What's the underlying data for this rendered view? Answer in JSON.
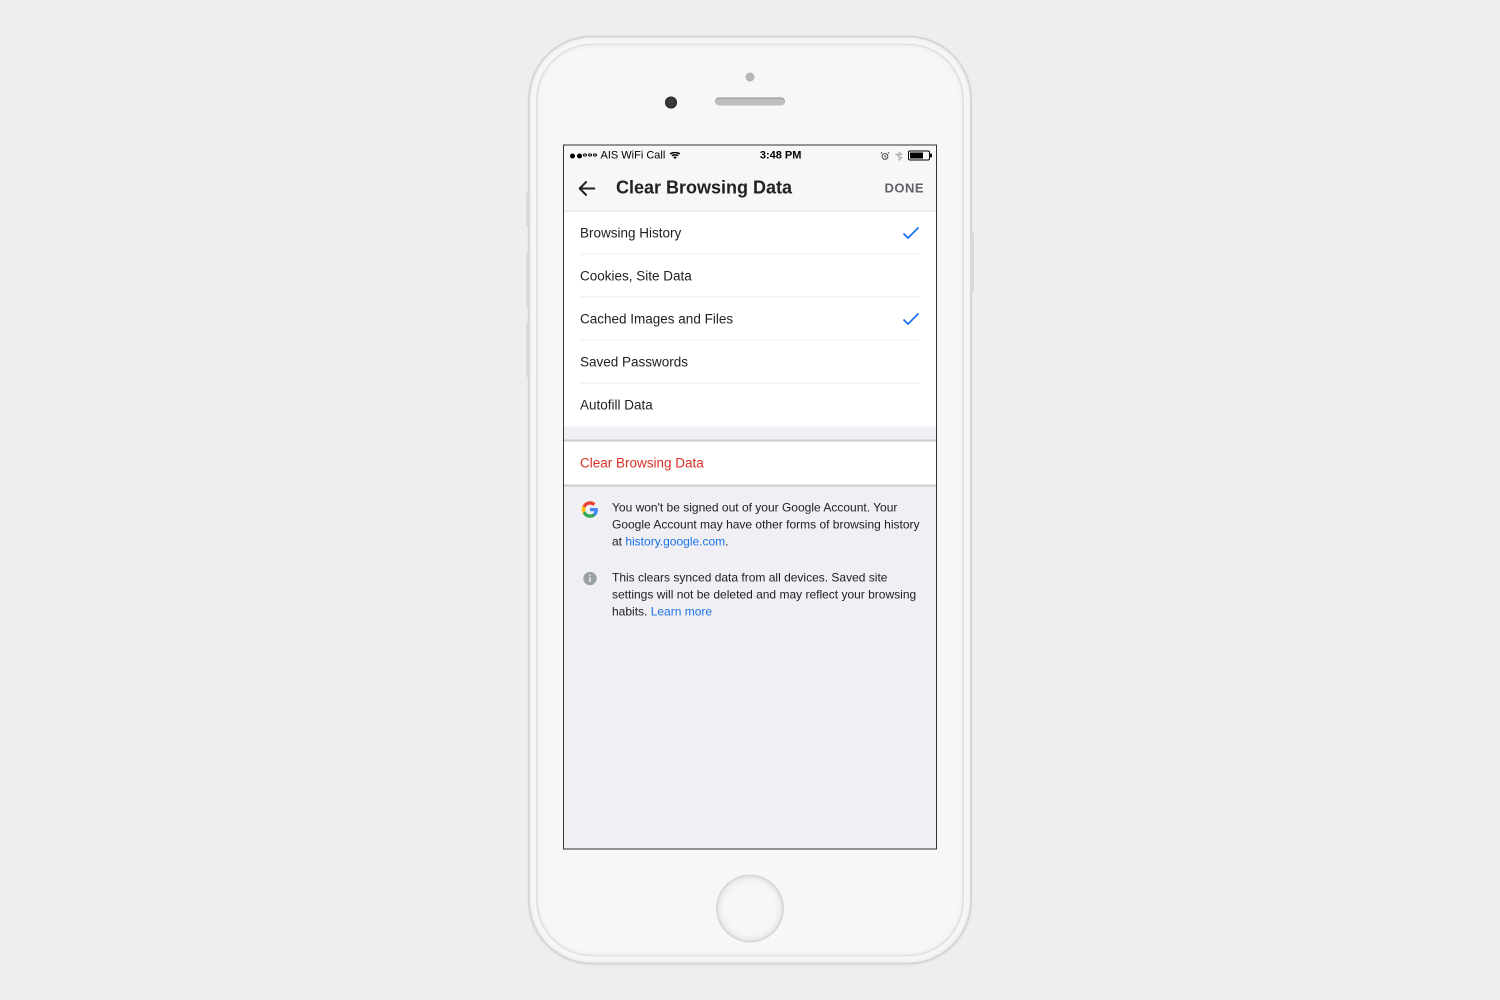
{
  "status": {
    "carrier": "AIS WiFi Call",
    "time": "3:48 PM"
  },
  "header": {
    "title": "Clear Browsing Data",
    "done": "DONE"
  },
  "options": [
    {
      "label": "Browsing History",
      "checked": true
    },
    {
      "label": "Cookies, Site Data",
      "checked": false
    },
    {
      "label": "Cached Images and Files",
      "checked": true
    },
    {
      "label": "Saved Passwords",
      "checked": false
    },
    {
      "label": "Autofill Data",
      "checked": false
    }
  ],
  "action": {
    "clear_label": "Clear Browsing Data"
  },
  "footnotes": {
    "google_pre": "You won't be signed out of your Google Account. Your Google Account may have other forms of browsing history at ",
    "google_link": "history.google.com",
    "google_post": ".",
    "sync_pre": "This clears synced data from all devices. Saved site settings will not be deleted and may reflect your browsing habits. ",
    "sync_link": "Learn more"
  }
}
